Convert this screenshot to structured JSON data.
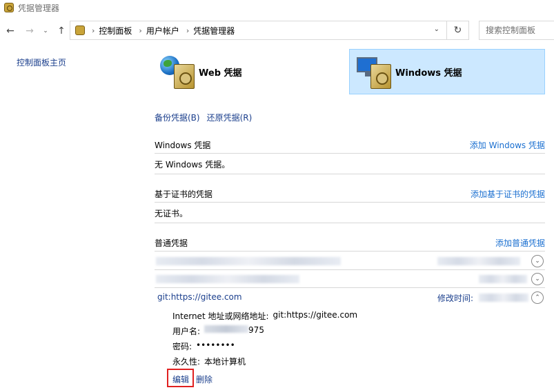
{
  "window": {
    "title": "凭据管理器"
  },
  "nav": {
    "back": "←",
    "forward": "→",
    "history": "⌄",
    "up": "↑"
  },
  "address": {
    "crumbs": [
      "控制面板",
      "用户帐户",
      "凭据管理器"
    ],
    "refresh": "↻",
    "search_placeholder": "搜索控制面板"
  },
  "left": {
    "home_link": "控制面板主页"
  },
  "vaults": {
    "web": "Web 凭据",
    "windows": "Windows 凭据",
    "selected": "windows"
  },
  "links": {
    "backup": "备份凭据(B)",
    "restore": "还原凭据(R)"
  },
  "sections": {
    "windows": {
      "title": "Windows 凭据",
      "action": "添加 Windows 凭据",
      "empty": "无 Windows 凭据。"
    },
    "certificate": {
      "title": "基于证书的凭据",
      "action": "添加基于证书的凭据",
      "empty": "无证书。"
    },
    "generic": {
      "title": "普通凭据",
      "action": "添加普通凭据"
    }
  },
  "credential": {
    "name": "git:https://gitee.com",
    "modified_label": "修改时间:",
    "address_label": "Internet 地址或网络地址:",
    "address_value": "git:https://gitee.com",
    "username_label": "用户名:",
    "username_value": "975",
    "password_label": "密码:",
    "password_value": "••••••••",
    "persistence_label": "永久性:",
    "persistence_value": "本地计算机",
    "edit": "编辑",
    "delete": "删除"
  }
}
